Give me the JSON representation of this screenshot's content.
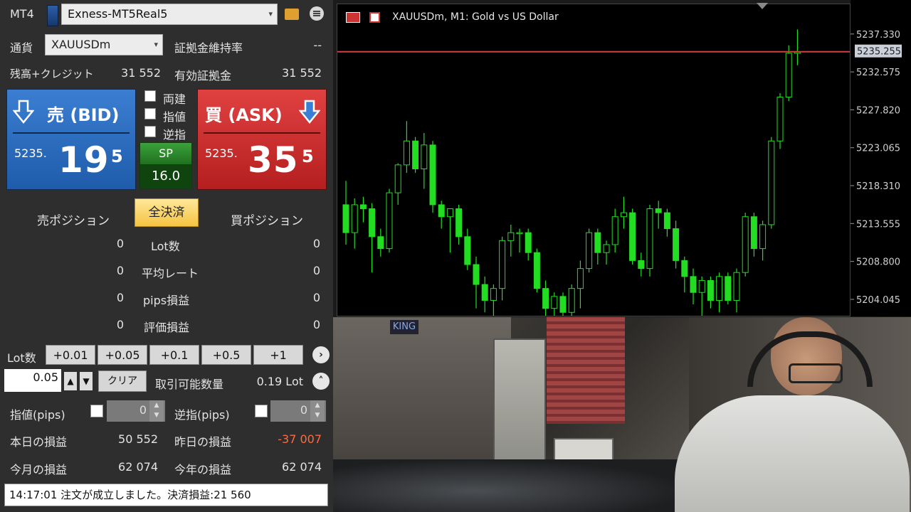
{
  "header": {
    "platform_label": "MT4",
    "account": "Exness-MT5Real5"
  },
  "info": {
    "currency_label": "通貨",
    "symbol": "XAUUSDm",
    "margin_level_label": "証拠金維持率",
    "margin_level_value": "--",
    "balance_label": "残高+クレジット",
    "balance_value": "31 552",
    "equity_label": "有効証拠金",
    "equity_value": "31 552"
  },
  "sell": {
    "label": "売 (BID)",
    "price_prefix": "5235.",
    "price_main": "19",
    "price_sup": "5"
  },
  "buy": {
    "label": "買 (ASK)",
    "price_prefix": "5235.",
    "price_main": "35",
    "price_sup": "5"
  },
  "spread": {
    "label": "SP",
    "value": "16.0"
  },
  "options": {
    "hedge": "両建",
    "limit": "指値",
    "stop": "逆指"
  },
  "positions": {
    "sell_label": "売ポジション",
    "close_all": "全決済",
    "buy_label": "買ポジション",
    "rows": [
      {
        "sell": "0",
        "label": "Lot数",
        "buy": "0"
      },
      {
        "sell": "0",
        "label": "平均レート",
        "buy": "0"
      },
      {
        "sell": "0",
        "label": "pips損益",
        "buy": "0"
      },
      {
        "sell": "0",
        "label": "評価損益",
        "buy": "0"
      }
    ]
  },
  "lot": {
    "label": "Lot数",
    "increments": [
      "+0.01",
      "+0.05",
      "+0.1",
      "+0.5",
      "+1"
    ],
    "value": "0.05",
    "clear": "クリア",
    "available_label": "取引可能数量",
    "available_value": "0.19 Lot"
  },
  "pips": {
    "limit_label": "指値(pips)",
    "limit_value": "0",
    "stop_label": "逆指(pips)",
    "stop_value": "0"
  },
  "pnl": {
    "today_label": "本日の損益",
    "today_value": "50 552",
    "yesterday_label": "昨日の損益",
    "yesterday_value": "-37 007",
    "month_label": "今月の損益",
    "month_value": "62 074",
    "year_label": "今年の損益",
    "year_value": "62 074"
  },
  "status_message": "14:17:01 注文が成立しました。決済損益:21 560",
  "chart": {
    "title": "XAUUSDm, M1:  Gold vs US Dollar",
    "current_price_label": "5235.255",
    "ticks": [
      "5237.330",
      "5232.575",
      "5227.820",
      "5223.065",
      "5218.310",
      "5213.555",
      "5208.800",
      "5204.045"
    ]
  },
  "video": {
    "sign_text": "KING"
  },
  "colors": {
    "bull": "#22dd22",
    "price_line": "#d04040",
    "sell_blue": "#2a6bc0",
    "buy_red": "#c92c2c",
    "loss": "#ff6a3d"
  },
  "chart_data": {
    "type": "candlestick",
    "ylim": [
      5201.9,
      5239.9
    ],
    "candles": [
      [
        5216.0,
        5219.0,
        5211.0,
        5212.5
      ],
      [
        5212.5,
        5216.8,
        5210.5,
        5216.0
      ],
      [
        5216.0,
        5217.0,
        5213.8,
        5215.5
      ],
      [
        5215.5,
        5216.2,
        5207.5,
        5212.0
      ],
      [
        5212.0,
        5213.0,
        5209.5,
        5210.5
      ],
      [
        5210.5,
        5218.0,
        5210.0,
        5217.5
      ],
      [
        5217.5,
        5221.2,
        5216.0,
        5221.0
      ],
      [
        5221.0,
        5226.5,
        5220.0,
        5224.0
      ],
      [
        5224.0,
        5224.5,
        5220.0,
        5220.5
      ],
      [
        5220.5,
        5225.0,
        5218.0,
        5223.5
      ],
      [
        5223.5,
        5224.0,
        5215.0,
        5216.0
      ],
      [
        5216.0,
        5216.5,
        5213.0,
        5214.5
      ],
      [
        5214.5,
        5215.5,
        5210.0,
        5215.5
      ],
      [
        5215.5,
        5216.0,
        5211.0,
        5212.0
      ],
      [
        5212.0,
        5213.0,
        5207.8,
        5208.5
      ],
      [
        5208.5,
        5209.5,
        5203.0,
        5206.0
      ],
      [
        5206.0,
        5207.0,
        5202.5,
        5204.0
      ],
      [
        5204.0,
        5206.0,
        5201.2,
        5205.5
      ],
      [
        5205.5,
        5212.0,
        5204.0,
        5211.5
      ],
      [
        5211.5,
        5213.5,
        5209.5,
        5212.5
      ],
      [
        5212.5,
        5213.0,
        5210.0,
        5212.5
      ],
      [
        5212.5,
        5213.0,
        5209.0,
        5210.0
      ],
      [
        5210.0,
        5210.5,
        5205.0,
        5205.5
      ],
      [
        5205.5,
        5206.5,
        5200.0,
        5203.0
      ],
      [
        5203.0,
        5205.0,
        5201.5,
        5204.5
      ],
      [
        5204.5,
        5205.0,
        5201.0,
        5202.5
      ],
      [
        5202.5,
        5206.0,
        5201.5,
        5205.5
      ],
      [
        5205.5,
        5209.0,
        5203.0,
        5208.0
      ],
      [
        5208.0,
        5213.0,
        5207.5,
        5212.5
      ],
      [
        5212.5,
        5213.0,
        5208.5,
        5210.0
      ],
      [
        5210.0,
        5211.5,
        5208.5,
        5211.0
      ],
      [
        5211.0,
        5215.5,
        5210.0,
        5214.5
      ],
      [
        5214.5,
        5217.0,
        5213.0,
        5215.0
      ],
      [
        5215.0,
        5215.5,
        5208.5,
        5209.0
      ],
      [
        5209.0,
        5210.0,
        5207.0,
        5208.0
      ],
      [
        5208.0,
        5216.0,
        5207.0,
        5215.5
      ],
      [
        5215.5,
        5216.5,
        5213.0,
        5215.0
      ],
      [
        5215.0,
        5215.5,
        5212.0,
        5213.0
      ],
      [
        5213.0,
        5214.0,
        5208.0,
        5209.0
      ],
      [
        5209.0,
        5209.5,
        5205.0,
        5207.0
      ],
      [
        5207.0,
        5208.0,
        5203.5,
        5205.0
      ],
      [
        5205.0,
        5207.0,
        5202.0,
        5206.5
      ],
      [
        5206.5,
        5207.0,
        5203.0,
        5204.0
      ],
      [
        5204.0,
        5207.5,
        5202.5,
        5207.0
      ],
      [
        5207.0,
        5207.5,
        5203.5,
        5204.0
      ],
      [
        5204.0,
        5208.0,
        5202.5,
        5207.5
      ],
      [
        5207.5,
        5215.0,
        5207.0,
        5214.5
      ],
      [
        5214.5,
        5215.0,
        5209.5,
        5210.5
      ],
      [
        5210.5,
        5214.0,
        5209.0,
        5213.5
      ],
      [
        5213.5,
        5224.5,
        5213.0,
        5224.0
      ],
      [
        5224.0,
        5230.0,
        5223.0,
        5229.5
      ],
      [
        5229.5,
        5236.0,
        5229.0,
        5235.0
      ],
      [
        5235.0,
        5238.0,
        5233.5,
        5235.2
      ]
    ]
  }
}
